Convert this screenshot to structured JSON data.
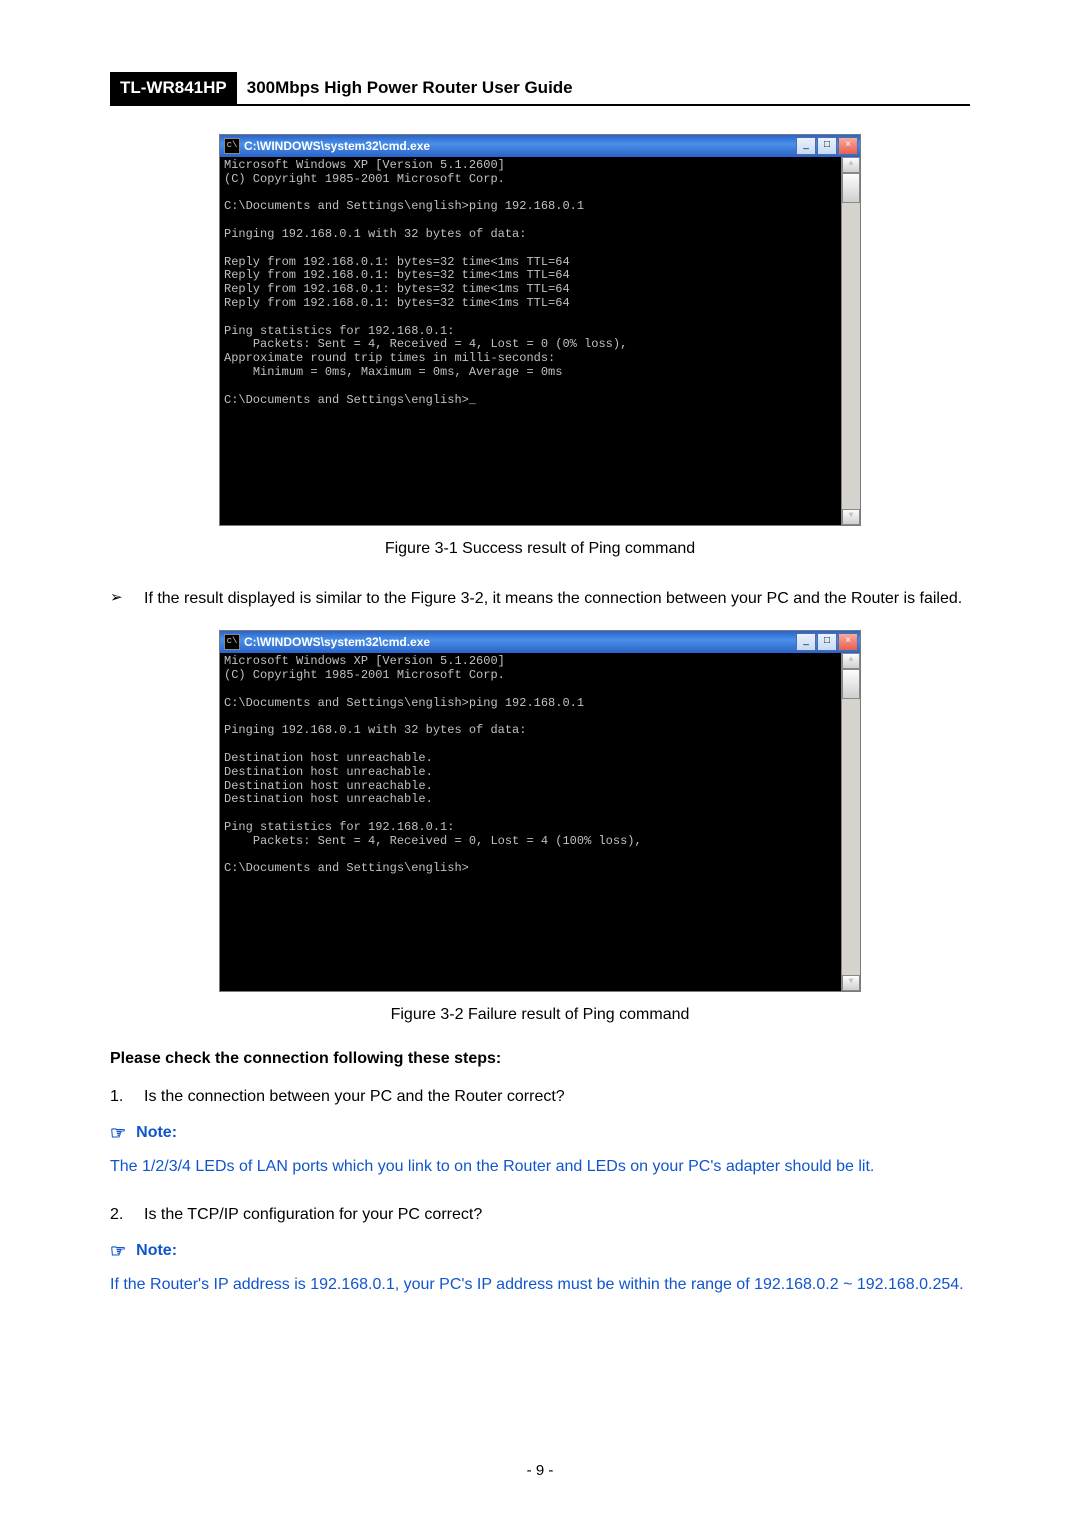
{
  "header": {
    "model": "TL-WR841HP",
    "title": "300Mbps High Power Router User Guide"
  },
  "cmd1": {
    "title": "C:\\WINDOWS\\system32\\cmd.exe",
    "body": "Microsoft Windows XP [Version 5.1.2600]\n(C) Copyright 1985-2001 Microsoft Corp.\n\nC:\\Documents and Settings\\english>ping 192.168.0.1\n\nPinging 192.168.0.1 with 32 bytes of data:\n\nReply from 192.168.0.1: bytes=32 time<1ms TTL=64\nReply from 192.168.0.1: bytes=32 time<1ms TTL=64\nReply from 192.168.0.1: bytes=32 time<1ms TTL=64\nReply from 192.168.0.1: bytes=32 time<1ms TTL=64\n\nPing statistics for 192.168.0.1:\n    Packets: Sent = 4, Received = 4, Lost = 0 (0% loss),\nApproximate round trip times in milli-seconds:\n    Minimum = 0ms, Maximum = 0ms, Average = 0ms\n\nC:\\Documents and Settings\\english>_"
  },
  "caption1": "Figure 3-1   Success result of Ping command",
  "bullet_failure": "If the result displayed is similar to the Figure 3-2, it means the connection between your PC and the Router is failed.",
  "cmd2": {
    "title": "C:\\WINDOWS\\system32\\cmd.exe",
    "body": "Microsoft Windows XP [Version 5.1.2600]\n(C) Copyright 1985-2001 Microsoft Corp.\n\nC:\\Documents and Settings\\english>ping 192.168.0.1\n\nPinging 192.168.0.1 with 32 bytes of data:\n\nDestination host unreachable.\nDestination host unreachable.\nDestination host unreachable.\nDestination host unreachable.\n\nPing statistics for 192.168.0.1:\n    Packets: Sent = 4, Received = 0, Lost = 4 (100% loss),\n\nC:\\Documents and Settings\\english>"
  },
  "caption2": "Figure 3-2   Failure result of Ping command",
  "steps_heading": "Please check the connection following these steps:",
  "step1_num": "1.",
  "step1": "Is the connection between your PC and the Router correct?",
  "note_label": "Note:",
  "note1_body": "The 1/2/3/4 LEDs of LAN ports which you link to on the Router and LEDs on your PC's adapter should be lit.",
  "step2_num": "2.",
  "step2": "Is the TCP/IP configuration for your PC correct?",
  "note2_body": "If the Router's IP address is 192.168.0.1, your PC's IP address must be within the range of 192.168.0.2 ~ 192.168.0.254.",
  "page_number": "- 9 -",
  "win_controls": {
    "min": "_",
    "max": "□",
    "close": "×",
    "up": "▲",
    "down": "▼"
  },
  "hand_icon": "☞",
  "bullet_icon": "➢",
  "cmd_icon": "c\\"
}
